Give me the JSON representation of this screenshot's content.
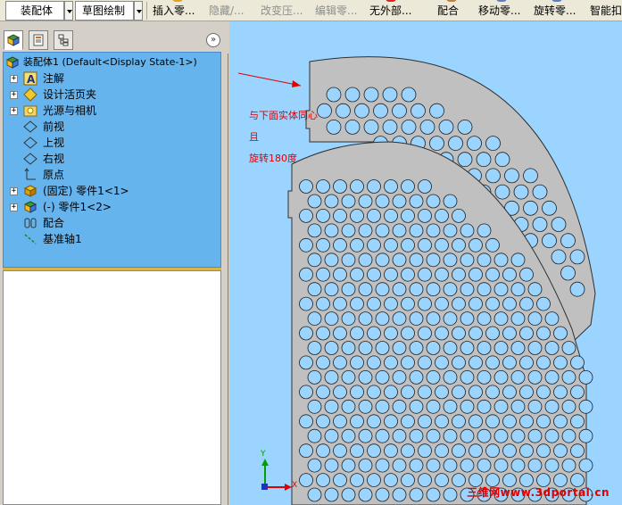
{
  "toolbar": {
    "assembly_label": "装配体",
    "sketch_label": "草图绘制",
    "insert_label": "插入零...",
    "hide_label": "隐藏/...",
    "change_label": "改变压...",
    "edit_label": "编辑零...",
    "external_label": "无外部...",
    "mate_label": "配合",
    "move_label": "移动零...",
    "rotate_label": "旋转零...",
    "smart_label": "智能扣"
  },
  "panel": {
    "tabs": [
      "feature-manager",
      "property-manager",
      "configuration-manager"
    ]
  },
  "tree": {
    "root_label": "装配体1  (Default<Display State-1>)",
    "items": [
      {
        "label": "注解",
        "expandable": true
      },
      {
        "label": "设计活页夹",
        "expandable": true
      },
      {
        "label": "光源与相机",
        "expandable": true
      },
      {
        "label": "前视",
        "expandable": false
      },
      {
        "label": "上视",
        "expandable": false
      },
      {
        "label": "右视",
        "expandable": false
      },
      {
        "label": "原点",
        "expandable": false
      },
      {
        "label": "(固定) 零件1<1>",
        "expandable": true
      },
      {
        "label": "(-) 零件1<2>",
        "expandable": true
      },
      {
        "label": "配合",
        "expandable": false
      },
      {
        "label": "基准轴1",
        "expandable": false
      }
    ]
  },
  "viewport": {
    "note_line1": "与下面实体同心",
    "note_line2": "且",
    "note_line3": "旋转180度",
    "watermark": "三维网www.3dportal.cn",
    "triad_y": "Y",
    "triad_x": "X"
  },
  "colors": {
    "viewport_bg": "#9ad4ff",
    "part_fill": "#c0c0c0",
    "hole_fill": "#9ad4ff",
    "tree_bg": "#66b4ee",
    "annotation_red": "#e00000"
  }
}
